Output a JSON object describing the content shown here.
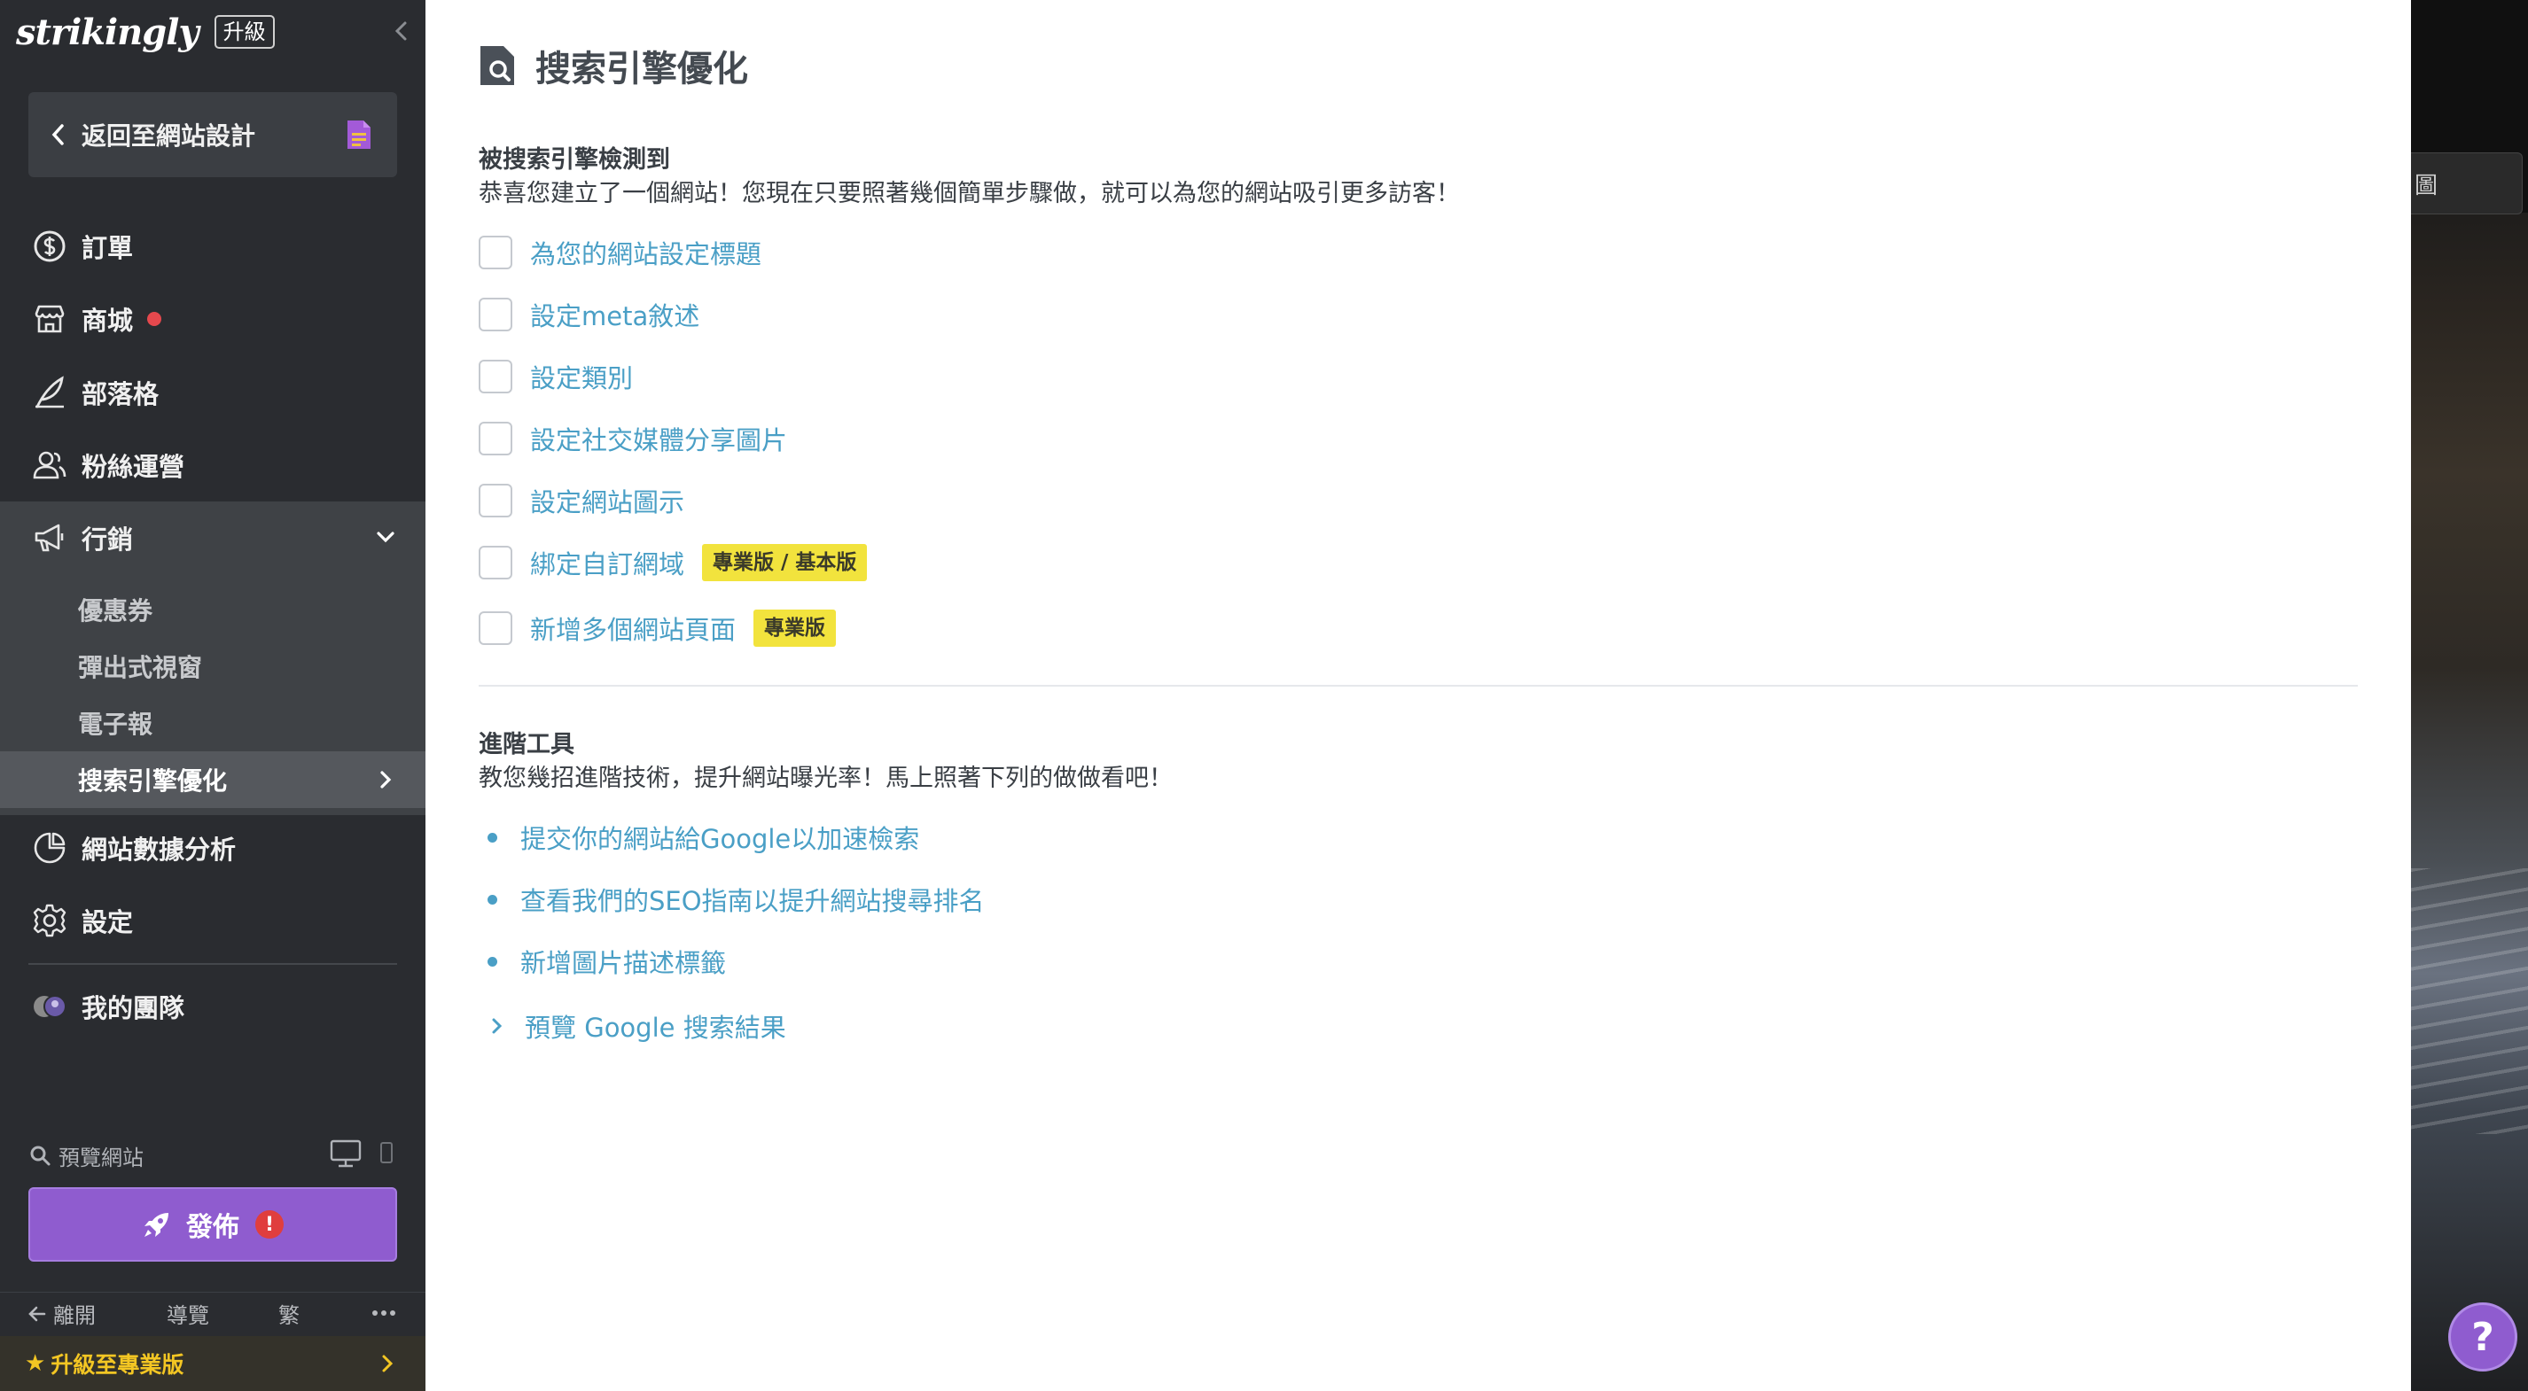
{
  "brand": {
    "logo": "strikingly",
    "upgrade_badge": "升級"
  },
  "sidebar": {
    "back_button": "返回至網站設計",
    "items": [
      {
        "label": "訂單",
        "icon": "dollar-circle-icon"
      },
      {
        "label": "商城",
        "icon": "store-icon"
      },
      {
        "label": "部落格",
        "icon": "quill-pen-icon"
      },
      {
        "label": "粉絲運營",
        "icon": "users-icon"
      },
      {
        "label": "行銷",
        "icon": "megaphone-icon"
      },
      {
        "label": "網站數據分析",
        "icon": "pie-chart-icon"
      },
      {
        "label": "設定",
        "icon": "gear-icon"
      },
      {
        "label": "我的團隊",
        "icon": "team-avatars-icon"
      }
    ],
    "marketing_sub": [
      {
        "label": "優惠券"
      },
      {
        "label": "彈出式視窗"
      },
      {
        "label": "電子報"
      },
      {
        "label": "搜索引擎優化"
      }
    ],
    "preview_label": "預覽網站",
    "publish_label": "發佈",
    "publish_alert": "!",
    "footer": {
      "leave": "離開",
      "guide": "導覽",
      "lang": "繁"
    },
    "upgrade_bar": "升級至專業版"
  },
  "main": {
    "title": "搜索引擎優化",
    "detect_section": {
      "title": "被搜索引擎檢測到",
      "desc": "恭喜您建立了一個網站！您現在只要照著幾個簡單步驟做，就可以為您的網站吸引更多訪客！",
      "items": [
        {
          "label": "為您的網站設定標題"
        },
        {
          "label": "設定meta敘述"
        },
        {
          "label": "設定類別"
        },
        {
          "label": "設定社交媒體分享圖片"
        },
        {
          "label": "設定網站圖示"
        },
        {
          "label": "綁定自訂網域",
          "tag": "專業版 / 基本版"
        },
        {
          "label": "新增多個網站頁面",
          "tag": "專業版"
        }
      ]
    },
    "advanced_section": {
      "title": "進階工具",
      "desc": "教您幾招進階技術，提升網站曝光率！馬上照著下列的做做看吧！",
      "links": [
        {
          "label": "提交你的網站給Google以加速檢索"
        },
        {
          "label": "查看我們的SEO指南以提升網站搜尋排名"
        },
        {
          "label": "新增圖片描述標籤"
        }
      ],
      "expand_label": "預覽 Google 搜索結果"
    }
  },
  "background": {
    "partial_button": "圖"
  },
  "help_button": "?",
  "colors": {
    "accent": "#8f5ccf",
    "link": "#4a9fc6",
    "tag": "#f2e33d",
    "sidebar_bg": "#2a2c30",
    "alert": "#e5484d"
  }
}
